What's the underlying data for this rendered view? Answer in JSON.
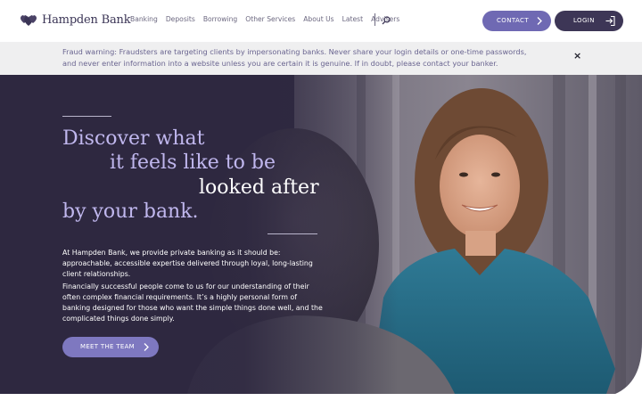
{
  "brand": {
    "name": "Hampden Bank"
  },
  "nav": {
    "items": [
      "Banking",
      "Deposits",
      "Borrowing",
      "Other Services",
      "About Us",
      "Latest",
      "Advisers"
    ]
  },
  "header": {
    "contact_label": "CONTACT",
    "login_label": "LOGIN"
  },
  "fraud_warning": {
    "text": "Fraud warning: Fraudsters are targeting clients by impersonating banks. Never share your login details or one-time passwords, and never enter information into a website unless you are certain it is genuine. If in doubt, please contact your banker.",
    "close_label": "×"
  },
  "hero": {
    "headline_line1": "Discover what",
    "headline_line2": "it feels like to be",
    "headline_line3": "looked after",
    "headline_line4": "by your bank.",
    "intro": "At Hampden Bank, we provide private banking as it should be: approachable, accessible expertise delivered through loyal, long-lasting client relationships.",
    "body": "Financially successful people come to us for our understanding of their often complex financial requirements. It’s a highly personal form of banking designed for those who want the simple things done well, and the complicated things done simply.",
    "cta_label": "MEET THE TEAM"
  },
  "colors": {
    "brand_dark": "#3d3656",
    "brand_accent": "#6f69b3",
    "headline_lilac": "#c0b7ee",
    "fraud_text": "#6a6590"
  },
  "icons": [
    "heart-logo-icon",
    "search-icon",
    "chevron-right-icon",
    "login-arrow-icon",
    "close-icon"
  ]
}
